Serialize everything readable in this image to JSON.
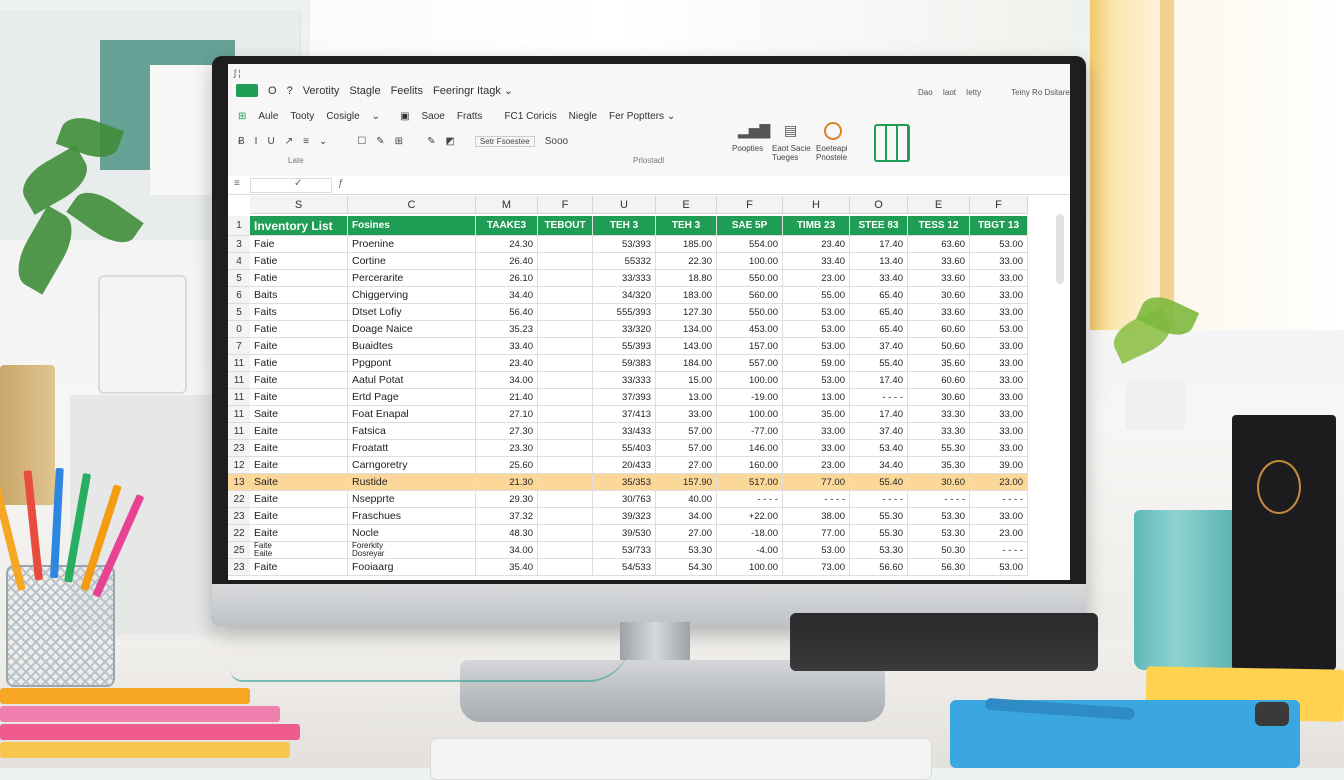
{
  "ribbon": {
    "quick_access": "ʃ ¦",
    "tabs": [
      "O",
      "?",
      "Verotity",
      "Stagle",
      "Feelits",
      "Feeringr Itagk ⌄"
    ],
    "row2": [
      "Aule",
      "Tooty",
      "Cosigle",
      "Saoe",
      "Fratts",
      "FC1 Coricis",
      "Niegle",
      "Fer Poptters ⌄"
    ],
    "format_box": "Setr Fsoestee",
    "format_text": "Sooo",
    "group_labels": [
      "Late",
      "Prlostadl"
    ],
    "big_buttons": [
      "Poopties",
      "Eaot Sacie Tueges",
      "Eoeteapi Pnostele"
    ],
    "status": [
      "Dao",
      "Iaot",
      "Ietty"
    ],
    "status_right": "Teiny Ro Dsitare"
  },
  "sheet": {
    "columns": [
      "S",
      "C",
      "M",
      "F",
      "U",
      "E",
      "F",
      "H",
      "O",
      "E",
      "F"
    ],
    "header_row_num": "1",
    "title": "Inventory List",
    "header": [
      "Fosines",
      "TAAKE3",
      "TEBOUT",
      "TEH 3",
      "TEH 3",
      "SAE 5P",
      "TIMB 23",
      "STEE 83",
      "TESS 12",
      "TBGT 13"
    ],
    "rows": [
      {
        "n": "3",
        "a": "Faie",
        "b": "Proenine",
        "v": [
          "24.30",
          "",
          "53/393",
          "185.00",
          "554.00",
          "23.40",
          "17.40",
          "63.60",
          "53.00"
        ]
      },
      {
        "n": "4",
        "a": "Fatie",
        "b": "Cortine",
        "v": [
          "26.40",
          "",
          "55332",
          "22.30",
          "100.00",
          "33.40",
          "13.40",
          "33.60",
          "33.00"
        ]
      },
      {
        "n": "5",
        "a": "Fatie",
        "b": "Percerarite",
        "v": [
          "26.10",
          "",
          "33/333",
          "18.80",
          "550.00",
          "23.00",
          "33.40",
          "33.60",
          "33.00"
        ]
      },
      {
        "n": "6",
        "a": "Baits",
        "b": "Chiggerving",
        "v": [
          "34.40",
          "",
          "34/320",
          "183.00",
          "560.00",
          "55.00",
          "65.40",
          "30.60",
          "33.00"
        ]
      },
      {
        "n": "5",
        "a": "Faits",
        "b": "Dtset Lofiy",
        "v": [
          "56.40",
          "",
          "555/393",
          "127.30",
          "550.00",
          "53.00",
          "65.40",
          "33.60",
          "33.00"
        ]
      },
      {
        "n": "0",
        "a": "Fatie",
        "b": "Doage Naice",
        "v": [
          "35.23",
          "",
          "33/320",
          "134.00",
          "453.00",
          "53.00",
          "65.40",
          "60.60",
          "53.00"
        ]
      },
      {
        "n": "7",
        "a": "Faite",
        "b": "Buaidtes",
        "v": [
          "33.40",
          "",
          "55/393",
          "143.00",
          "157.00",
          "53.00",
          "37.40",
          "50.60",
          "33.00"
        ]
      },
      {
        "n": "11",
        "a": "Fatie",
        "b": "Ppgpont",
        "v": [
          "23.40",
          "",
          "59/383",
          "184.00",
          "557.00",
          "59.00",
          "55.40",
          "35.60",
          "33.00"
        ]
      },
      {
        "n": "11",
        "a": "Faite",
        "b": "Aatul Potat",
        "v": [
          "34.00",
          "",
          "33/333",
          "15.00",
          "100.00",
          "53.00",
          "17.40",
          "60.60",
          "33.00"
        ]
      },
      {
        "n": "11",
        "a": "Faite",
        "b": "Ertd Page",
        "v": [
          "21.40",
          "",
          "37/393",
          "13.00",
          "-19.00",
          "13.00",
          "- - - -",
          "30.60",
          "33.00"
        ]
      },
      {
        "n": "11",
        "a": "Saite",
        "b": "Foat Enapal",
        "v": [
          "27.10",
          "",
          "37/413",
          "33.00",
          "100.00",
          "35.00",
          "17.40",
          "33.30",
          "33.00"
        ]
      },
      {
        "n": "11",
        "a": "Eaite",
        "b": "Fatsica",
        "v": [
          "27.30",
          "",
          "33/433",
          "57.00",
          "-77.00",
          "33.00",
          "37.40",
          "33.30",
          "33.00"
        ]
      },
      {
        "n": "23",
        "a": "Eaite",
        "b": "Froatatt",
        "v": [
          "23.30",
          "",
          "55/403",
          "57.00",
          "146.00",
          "33.00",
          "53.40",
          "55.30",
          "33.00"
        ]
      },
      {
        "n": "12",
        "a": "Eaite",
        "b": "Carngoretry",
        "v": [
          "25.60",
          "",
          "20/433",
          "27.00",
          "160.00",
          "23.00",
          "34.40",
          "35.30",
          "39.00"
        ]
      },
      {
        "n": "13",
        "a": "Saite",
        "b": "Rustide",
        "v": [
          "21.30",
          "",
          "35/353",
          "157.90",
          "517.00",
          "77.00",
          "55.40",
          "30.60",
          "23.00"
        ],
        "highlight": true
      },
      {
        "n": "22",
        "a": "Eaite",
        "b": "Nsepprte",
        "v": [
          "29.30",
          "",
          "30/763",
          "40.00",
          "- - - -",
          "- - - -",
          "- - - -",
          "- - - -",
          "- - - -"
        ]
      },
      {
        "n": "23",
        "a": "Eaite",
        "b": "Fraschues",
        "v": [
          "37.32",
          "",
          "39/323",
          "34.00",
          "+22.00",
          "38.00",
          "55.30",
          "53.30",
          "33.00"
        ]
      },
      {
        "n": "22",
        "a": "Eaite",
        "b": "Nocle",
        "v": [
          "48.30",
          "",
          "39/530",
          "27.00",
          "-18.00",
          "77.00",
          "55.30",
          "53.30",
          "23.00"
        ]
      },
      {
        "n": "25",
        "a": "Faite\nEaite",
        "b": "Forerkity\nDosreyar",
        "v": [
          "34.00",
          "",
          "53/733",
          "53.30",
          "-4.00",
          "53.00",
          "53.30",
          "50.30",
          "- - - -"
        ]
      },
      {
        "n": "23",
        "a": "Faite",
        "b": "Fooiaarg",
        "v": [
          "35.40",
          "",
          "54/533",
          "54.30",
          "100.00",
          "73.00",
          "56.60",
          "56.30",
          "53.00"
        ]
      }
    ]
  },
  "colors": {
    "header_green": "#1f9d55",
    "highlight_orange": "#fbd79a"
  }
}
